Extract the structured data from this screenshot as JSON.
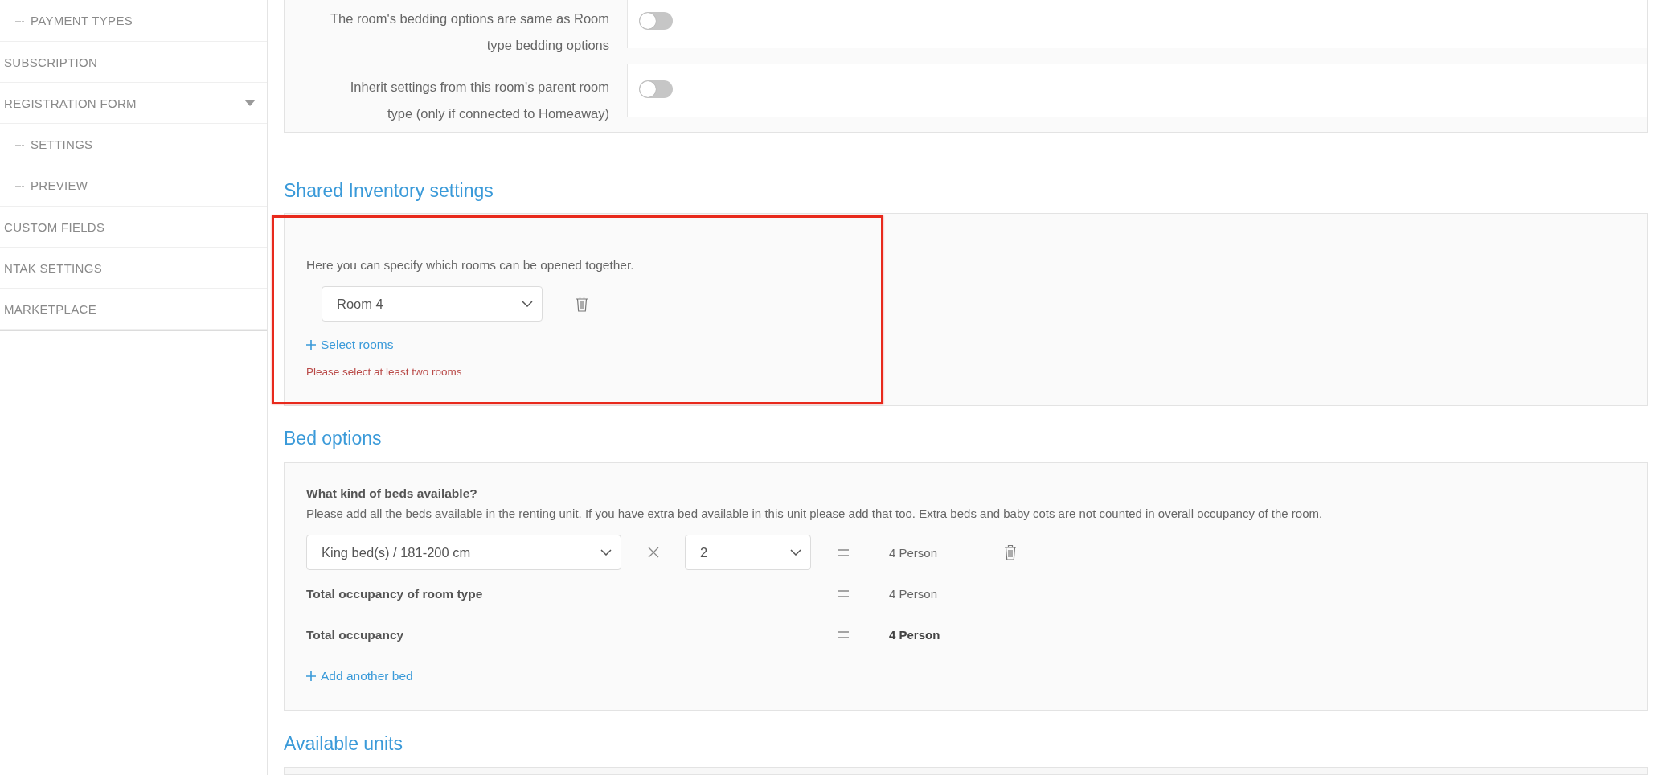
{
  "sidebar": {
    "items": [
      {
        "children": [
          {
            "label": "PAYMENT TYPES"
          }
        ]
      },
      {
        "label": "SUBSCRIPTION"
      },
      {
        "label": "REGISTRATION FORM",
        "expanded": true,
        "children": [
          {
            "label": "SETTINGS"
          },
          {
            "label": "PREVIEW"
          }
        ]
      },
      {
        "label": "CUSTOM FIELDS"
      },
      {
        "label": "NTAK SETTINGS"
      },
      {
        "label": "MARKETPLACE"
      }
    ]
  },
  "room_settings": {
    "toggles": [
      {
        "label": "The room's bedding options are same as Room type bedding options",
        "on": false
      },
      {
        "label": "Inherit settings from this room's parent room type (only if connected to Homeaway)",
        "on": false
      }
    ]
  },
  "shared_inventory": {
    "title": "Shared Inventory settings",
    "highlighted": true,
    "hint": "Here you can specify which rooms can be opened together.",
    "rooms": [
      {
        "value": "Room 4"
      }
    ],
    "add_link": "Select rooms",
    "error": "Please select at least two rooms"
  },
  "bed_options": {
    "title": "Bed options",
    "question": "What kind of beds available?",
    "description": "Please add all the beds available in the renting unit. If you have extra bed available in this unit please add that too. Extra beds and baby cots are not counted in overall occupancy of the room.",
    "beds": [
      {
        "type": "King bed(s) / 181-200 cm",
        "count": "2",
        "occupancy": "4 Person"
      }
    ],
    "totals": [
      {
        "kind": "subtotal",
        "label": "Total occupancy of room type",
        "value": "4 Person"
      },
      {
        "kind": "total",
        "label": "Total occupancy",
        "value": "4 Person"
      }
    ],
    "add_link": "Add another bed"
  },
  "available_units": {
    "title": "Available units"
  }
}
